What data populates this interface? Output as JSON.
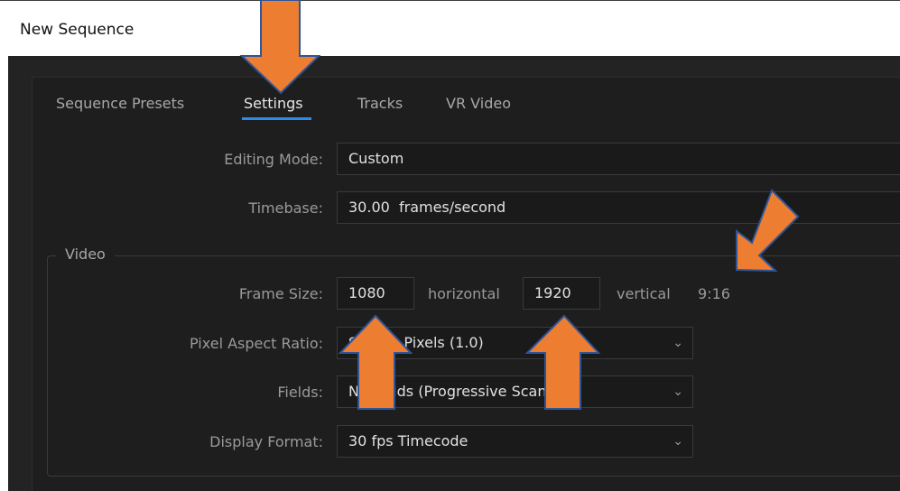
{
  "window": {
    "title": "New Sequence"
  },
  "tabs": [
    {
      "label": "Sequence Presets"
    },
    {
      "label": "Settings"
    },
    {
      "label": "Tracks"
    },
    {
      "label": "VR Video"
    }
  ],
  "settings": {
    "editing_mode": {
      "label": "Editing Mode:",
      "value": "Custom"
    },
    "timebase": {
      "label": "Timebase:",
      "value": "30.00  frames/second"
    }
  },
  "video": {
    "group_label": "Video",
    "frame_size": {
      "label": "Frame Size:",
      "horizontal_value": "1080",
      "horizontal_label": "horizontal",
      "vertical_value": "1920",
      "vertical_label": "vertical",
      "aspect": "9:16"
    },
    "pixel_aspect_ratio": {
      "label": "Pixel Aspect Ratio:",
      "value": "Square Pixels (1.0)"
    },
    "fields": {
      "label": "Fields:",
      "value": "No Fields (Progressive Scan)"
    },
    "display_format": {
      "label": "Display Format:",
      "value": "30 fps Timecode"
    }
  },
  "colors": {
    "accent": "#2d8ceb",
    "annotation_arrow": "#ed7d31",
    "annotation_outline": "#2f5597"
  },
  "annotations": {
    "arrow_icon": "orange-arrow-icon"
  }
}
